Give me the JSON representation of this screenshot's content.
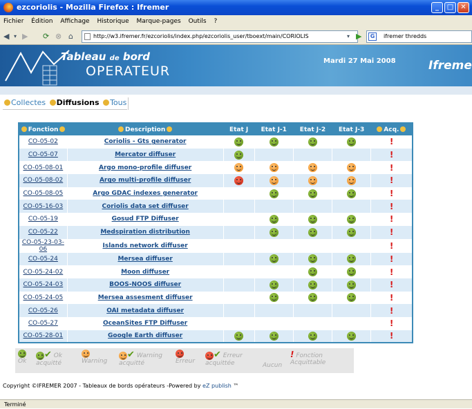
{
  "window": {
    "title": "ezcoriolis - Mozilla Firefox : Ifremer"
  },
  "menubar": {
    "items": [
      "Fichier",
      "Édition",
      "Affichage",
      "Historique",
      "Marque-pages",
      "Outils",
      "?"
    ]
  },
  "navbar": {
    "url": "http://w3.ifremer.fr/ezcoriolis/index.php/ezcoriolis_user/tboext/main/CORIOLIS",
    "search_value": "ifremer thredds"
  },
  "banner": {
    "title1": "Tableau",
    "title_de": "de",
    "title2": "bord",
    "subtitle": "OPERATEUR",
    "date": "Mardi 27 Mai 2008",
    "logo": "Ifremer"
  },
  "tabs": [
    "Collectes",
    "Diffusions",
    "Tous"
  ],
  "table": {
    "headers": [
      "Fonction",
      "Description",
      "Etat J",
      "Etat J-1",
      "Etat J-2",
      "Etat J-3",
      "Acq."
    ],
    "rows": [
      {
        "code": "CO-05-02",
        "desc": "Coriolis - Gts generator",
        "j": "ok",
        "j1": "ok",
        "j2": "ok",
        "j3": "ok",
        "acq": "!"
      },
      {
        "code": "CO-05-07",
        "desc": "Mercator diffuser",
        "j": "ok",
        "j1": "",
        "j2": "",
        "j3": "",
        "acq": "!"
      },
      {
        "code": "CO-05-08-01",
        "desc": "Argo mono-profile diffuser",
        "j": "warn",
        "j1": "warn",
        "j2": "warn",
        "j3": "warn",
        "acq": "!"
      },
      {
        "code": "CO-05-08-02",
        "desc": "Argo multi-profile diffuser",
        "j": "err",
        "j1": "warn",
        "j2": "warn",
        "j3": "warn",
        "acq": "!"
      },
      {
        "code": "CO-05-08-05",
        "desc": "Argo GDAC indexes generator",
        "j": "",
        "j1": "ok",
        "j2": "ok",
        "j3": "ok",
        "acq": "!"
      },
      {
        "code": "CO-05-16-03",
        "desc": "Coriolis data set diffuser",
        "j": "",
        "j1": "",
        "j2": "",
        "j3": "",
        "acq": "!"
      },
      {
        "code": "CO-05-19",
        "desc": "Gosud FTP Diffuser",
        "j": "",
        "j1": "ok",
        "j2": "ok",
        "j3": "ok",
        "acq": "!"
      },
      {
        "code": "CO-05-22",
        "desc": "Medspiration distribution",
        "j": "",
        "j1": "ok",
        "j2": "ok",
        "j3": "ok",
        "acq": "!"
      },
      {
        "code": "CO-05-23-03-06",
        "desc": "Islands network diffuser",
        "j": "",
        "j1": "",
        "j2": "",
        "j3": "",
        "acq": "!"
      },
      {
        "code": "CO-05-24",
        "desc": "Mersea diffuser",
        "j": "",
        "j1": "ok",
        "j2": "ok",
        "j3": "ok",
        "acq": "!"
      },
      {
        "code": "CO-05-24-02",
        "desc": "Moon diffuser",
        "j": "",
        "j1": "",
        "j2": "ok",
        "j3": "ok",
        "acq": "!"
      },
      {
        "code": "CO-05-24-03",
        "desc": "BOOS-NOOS diffuser",
        "j": "",
        "j1": "ok",
        "j2": "ok",
        "j3": "ok",
        "acq": "!"
      },
      {
        "code": "CO-05-24-05",
        "desc": "Mersea assesment diffuser",
        "j": "",
        "j1": "ok",
        "j2": "ok",
        "j3": "ok",
        "acq": "!"
      },
      {
        "code": "CO-05-26",
        "desc": "OAI metadata diffuser",
        "j": "",
        "j1": "",
        "j2": "",
        "j3": "",
        "acq": "!"
      },
      {
        "code": "CO-05-27",
        "desc": "OceanSites FTP Diffuser",
        "j": "",
        "j1": "",
        "j2": "",
        "j3": "",
        "acq": "!"
      },
      {
        "code": "CO-05-28-01",
        "desc": "Google Earth diffuser",
        "j": "ok",
        "j1": "ok",
        "j2": "ok",
        "j3": "ok",
        "acq": "!"
      }
    ]
  },
  "legend": {
    "ok": "Ok",
    "ok_ack1": "Ok",
    "ok_ack2": "acquitté",
    "warning": "Warning",
    "warning_ack1": "Warning",
    "warning_ack2": "acquitté",
    "error": "Erreur",
    "error_ack1": "Erreur",
    "error_ack2": "acquittée",
    "none": "Aucun",
    "fonction1": "Fonction",
    "fonction2": "Acquittable"
  },
  "footer": {
    "text": "Copyright ©IFREMER 2007 - Tableaux de bords opérateurs -Powered by",
    "link": "eZ publish",
    "tm": "™"
  },
  "status": {
    "text": "Terminé"
  },
  "colors": {
    "header_blue": "#3c8ab7",
    "row_alt": "#dcebf7",
    "ok_green": "#6a9a1f",
    "warn_orange": "#f09a2a",
    "err_red": "#d8301a",
    "titlebar": "#0a4fd6"
  }
}
